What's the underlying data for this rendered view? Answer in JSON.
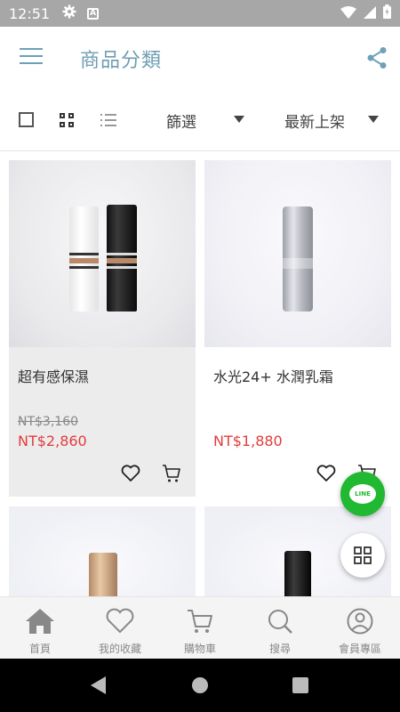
{
  "status_bar": {
    "time": "12:51",
    "settings_icon": "gear-icon",
    "app_icon": "a-box-icon",
    "app_icon_text": "A"
  },
  "app_bar": {
    "title": "商品分類",
    "menu_icon": "hamburger-menu-icon",
    "share_icon": "share-icon"
  },
  "toolbar": {
    "filter_label": "篩選",
    "sort_label": "最新上架"
  },
  "products": [
    {
      "name": "超有感保濕",
      "original_price": "NT$3,160",
      "price": "NT$2,860"
    },
    {
      "name": "水光24+ 水潤乳霜",
      "original_price": "",
      "price": "NT$1,880"
    }
  ],
  "line_button": {
    "label": "LINE"
  },
  "bottom_nav": [
    {
      "label": "首頁",
      "icon": "home-icon"
    },
    {
      "label": "我的收藏",
      "icon": "heart-icon"
    },
    {
      "label": "購物車",
      "icon": "cart-icon"
    },
    {
      "label": "搜尋",
      "icon": "search-icon"
    },
    {
      "label": "會員專區",
      "icon": "user-icon"
    }
  ],
  "colors": {
    "accent": "#6f9db2",
    "price_red": "#e23c3c",
    "line_green": "#21b832",
    "status_bar": "#a7a7a7"
  }
}
